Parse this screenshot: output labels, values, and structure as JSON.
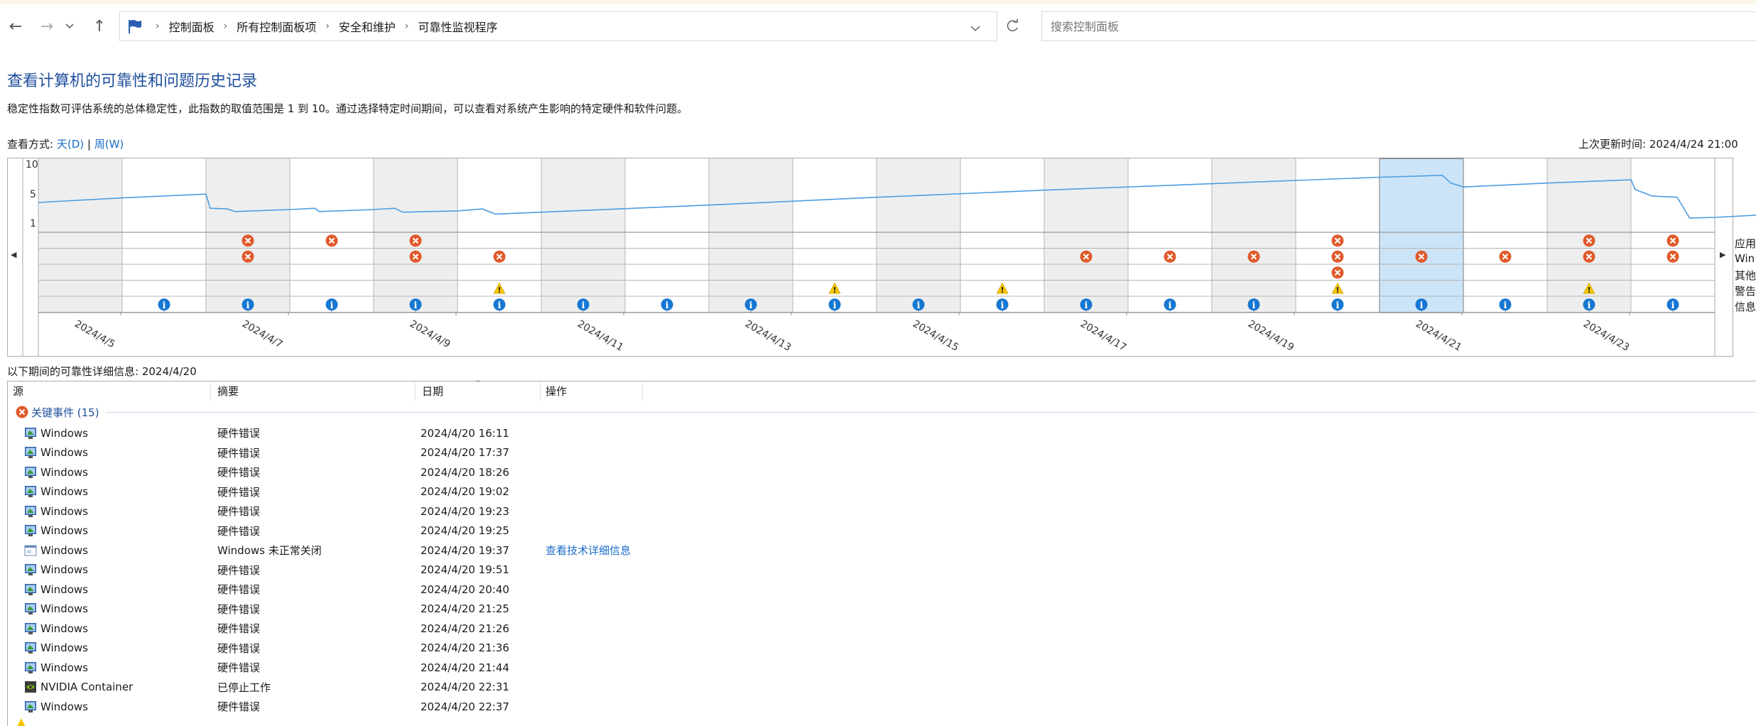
{
  "breadcrumb": [
    "控制面板",
    "所有控制面板项",
    "安全和维护",
    "可靠性监视程序"
  ],
  "search": {
    "placeholder": "搜索控制面板"
  },
  "page": {
    "title": "查看计算机的可靠性和问题历史记录",
    "description": "稳定性指数可评估系统的总体稳定性，此指数的取值范围是 1 到 10。通过选择特定时间期间，可以查看对系统产生影响的特定硬件和软件问题。",
    "view_label": "查看方式:",
    "view_day": "天(D)",
    "view_separator": "|",
    "view_week": "周(W)",
    "last_update": "上次更新时间: 2024/4/24 21:00"
  },
  "chart": {
    "y_ticks": [
      "10",
      "5",
      "1"
    ],
    "row_labels": [
      "应用",
      "Win",
      "其他",
      "警告",
      "信息"
    ],
    "date_labels": [
      "2024/4/5",
      "2024/4/7",
      "2024/4/9",
      "2024/4/11",
      "2024/4/13",
      "2024/4/15",
      "2024/4/17",
      "2024/4/19",
      "2024/4/21",
      "2024/4/23"
    ]
  },
  "chart_data": {
    "type": "line",
    "x": [
      "2024/4/4",
      "2024/4/5",
      "2024/4/6",
      "2024/4/7",
      "2024/4/8",
      "2024/4/9",
      "2024/4/10",
      "2024/4/11",
      "2024/4/12",
      "2024/4/13",
      "2024/4/14",
      "2024/4/15",
      "2024/4/16",
      "2024/4/17",
      "2024/4/18",
      "2024/4/19",
      "2024/4/20",
      "2024/4/21",
      "2024/4/22",
      "2024/4/23"
    ],
    "ylim": [
      1,
      10
    ],
    "y_ticks": [
      10,
      5,
      1
    ],
    "selected_day": "2024/4/20",
    "alternate_column_shading": true,
    "stability_index_points": [
      [
        0.0,
        4.4
      ],
      [
        1.0,
        5.1
      ],
      [
        2.0,
        5.7
      ],
      [
        2.05,
        3.5
      ],
      [
        2.25,
        3.4
      ],
      [
        2.35,
        3.0
      ],
      [
        3.0,
        3.3
      ],
      [
        3.3,
        3.5
      ],
      [
        3.35,
        3.0
      ],
      [
        4.0,
        3.3
      ],
      [
        4.25,
        3.5
      ],
      [
        4.35,
        2.9
      ],
      [
        5.0,
        3.1
      ],
      [
        5.3,
        3.4
      ],
      [
        5.45,
        2.6
      ],
      [
        6.0,
        2.9
      ],
      [
        8.0,
        4.0
      ],
      [
        10.0,
        5.2
      ],
      [
        12.0,
        6.3
      ],
      [
        14.0,
        7.3
      ],
      [
        15.0,
        7.8
      ],
      [
        16.0,
        8.3
      ],
      [
        16.75,
        8.6
      ],
      [
        16.85,
        7.4
      ],
      [
        17.0,
        6.8
      ],
      [
        17.0,
        6.8
      ],
      [
        18.0,
        7.4
      ],
      [
        19.0,
        7.9
      ],
      [
        19.05,
        6.4
      ],
      [
        19.25,
        5.4
      ],
      [
        19.55,
        5.2
      ],
      [
        19.7,
        2.0
      ],
      [
        20.0,
        2.1
      ],
      [
        20.75,
        2.6
      ],
      [
        21.0,
        1.6
      ],
      [
        21.1,
        1.0
      ]
    ],
    "events": {
      "应用": [
        2,
        3,
        4,
        15,
        18,
        19
      ],
      "Win": [
        2,
        4,
        5,
        12,
        13,
        14,
        15,
        16,
        17,
        18,
        19
      ],
      "其他": [
        15
      ],
      "警告": [
        5,
        9,
        11,
        15,
        18
      ],
      "信息": [
        1,
        2,
        3,
        4,
        5,
        6,
        7,
        8,
        9,
        10,
        11,
        12,
        13,
        14,
        15,
        16,
        17,
        18,
        19
      ]
    }
  },
  "details": {
    "header": "以下期间的可靠性详细信息: 2024/4/20",
    "columns": [
      "源",
      "摘要",
      "日期",
      "操作"
    ],
    "group_label": "关键事件 (15)",
    "rows": [
      {
        "source": "Windows",
        "summary": "硬件错误",
        "date": "2024/4/20 16:11",
        "action": "",
        "icon": "windows"
      },
      {
        "source": "Windows",
        "summary": "硬件错误",
        "date": "2024/4/20 17:37",
        "action": "",
        "icon": "windows"
      },
      {
        "source": "Windows",
        "summary": "硬件错误",
        "date": "2024/4/20 18:26",
        "action": "",
        "icon": "windows"
      },
      {
        "source": "Windows",
        "summary": "硬件错误",
        "date": "2024/4/20 19:02",
        "action": "",
        "icon": "windows"
      },
      {
        "source": "Windows",
        "summary": "硬件错误",
        "date": "2024/4/20 19:23",
        "action": "",
        "icon": "windows"
      },
      {
        "source": "Windows",
        "summary": "硬件错误",
        "date": "2024/4/20 19:25",
        "action": "",
        "icon": "windows"
      },
      {
        "source": "Windows",
        "summary": "Windows 未正常关闭",
        "date": "2024/4/20 19:37",
        "action": "查看技术详细信息",
        "icon": "window"
      },
      {
        "source": "Windows",
        "summary": "硬件错误",
        "date": "2024/4/20 19:51",
        "action": "",
        "icon": "windows"
      },
      {
        "source": "Windows",
        "summary": "硬件错误",
        "date": "2024/4/20 20:40",
        "action": "",
        "icon": "windows"
      },
      {
        "source": "Windows",
        "summary": "硬件错误",
        "date": "2024/4/20 21:25",
        "action": "",
        "icon": "windows"
      },
      {
        "source": "Windows",
        "summary": "硬件错误",
        "date": "2024/4/20 21:26",
        "action": "",
        "icon": "windows"
      },
      {
        "source": "Windows",
        "summary": "硬件错误",
        "date": "2024/4/20 21:36",
        "action": "",
        "icon": "windows"
      },
      {
        "source": "Windows",
        "summary": "硬件错误",
        "date": "2024/4/20 21:44",
        "action": "",
        "icon": "windows"
      },
      {
        "source": "NVIDIA Container",
        "summary": "已停止工作",
        "date": "2024/4/20 22:31",
        "action": "",
        "icon": "nvidia"
      },
      {
        "source": "Windows",
        "summary": "硬件错误",
        "date": "2024/4/20 22:37",
        "action": "",
        "icon": "windows"
      }
    ]
  },
  "colors": {
    "accent": "#1e4e9c",
    "link": "#1a6dc7",
    "line": "#4d9de0",
    "selected": "#cce4f7",
    "column_shade": "#eeeeee",
    "error": "#e05a2b",
    "warning": "#f5c400",
    "info": "#1677d2"
  }
}
